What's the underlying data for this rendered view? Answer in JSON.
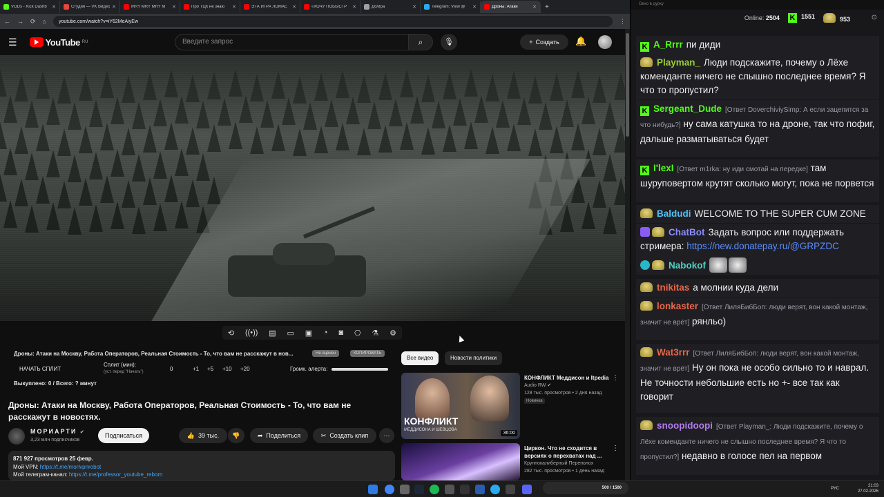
{
  "browser": {
    "tabs": [
      {
        "label": "VODs - Kick Dashb",
        "color": "#53fc18"
      },
      {
        "label": "Студия — VK Видео",
        "color": "#e8453c"
      },
      {
        "label": "MRY MRY MRY M",
        "color": "#ff0000"
      },
      {
        "label": "Про ТЦК не знаю",
        "color": "#ff0000"
      },
      {
        "label": "ЭТА ИГРА ЛОМАЕ",
        "color": "#ff0000"
      },
      {
        "label": "«ХОЧУ ПОБЫСТР",
        "color": "#ff0000"
      },
      {
        "label": "Дб/ира",
        "color": "#9aa0a6"
      },
      {
        "label": "Telegram: View @",
        "color": "#2aabee"
      },
      {
        "label": "Дроны: Атаки",
        "color": "#ff0000"
      }
    ],
    "url": "youtube.com/watch?v=iY62MeAiyEw"
  },
  "youtube": {
    "logo_text": "YouTube",
    "region": "RU",
    "search_placeholder": "Введите запрос",
    "create_label": "Создать",
    "ext": {
      "title": "Дроны: Атаки на Москву, Работа Операторов, Реальная Стоимость - То, что вам не расскажут в нов...",
      "btn_find": "Не оценен",
      "btn_copy": "КОПИРОВАТЬ",
      "start_split": "НАЧАТЬ СПЛИТ",
      "split_label": "Сплит (мин):",
      "split_sub": "(уст. перед \"Начать\")",
      "split_value": "0",
      "steps": [
        "+1",
        "+5",
        "+10",
        "+20"
      ],
      "alert_label": "Громк. алерта:",
      "done_text": "Выкуплено: 0 / Всего: ? минут"
    },
    "video_title": "Дроны: Атаки на Москву, Работа Операторов, Реальная Стоимость - То, что вам не расскажут в новостях.",
    "channel": {
      "name": "МОРИАРТИ",
      "subs": "3,23 млн подписчиков",
      "subscribe": "Подписаться"
    },
    "actions": {
      "likes": "39 тыс.",
      "share": "Поделиться",
      "clip": "Создать клип"
    },
    "description": {
      "stats": "871 927 просмотров  25 февр.",
      "vpn_label": "Мой VPN: ",
      "vpn_link": "https://t.me/morivpnrobot",
      "tg_label": "Мой телеграм-канал: ",
      "tg_link": "https://t.me/professor_youtube_reborn"
    },
    "chips": [
      "Все видео",
      "Новости политики"
    ],
    "recommendations": [
      {
        "title": "КОНФЛИКТ Меддисон и Itpedia",
        "channel": "Audio RW",
        "meta": "128 тыс. просмотров • 2 дня назад",
        "badge": "Новинка",
        "duration": "36:00",
        "thumb_text": "КОНФЛИКТ",
        "thumb_sub": "МЕДДИСОНА И ШЕВЦОВА"
      },
      {
        "title": "Циркон. Что не сходится в версиях о перехватах над ...",
        "channel": "Крупнокалиберный Переполох",
        "meta": "282 тыс. просмотров • 1 день назад"
      }
    ]
  },
  "chat": {
    "window_title": "Окно в дурку",
    "online_label": "Online:",
    "online": "2504",
    "kick_count": "1551",
    "other_count": "953",
    "messages": [
      {
        "user": "A_Rrrr",
        "color": "#53fc18",
        "icon": "k",
        "text": "пи диди"
      },
      {
        "user": "Playman_",
        "color": "#9acd32",
        "icon": "face",
        "text": "Люди подскажите, почему о Лёхе коменданте ничего не слышно последнее время? Я что то пропустил?"
      },
      {
        "user": "Sergeant_Dude",
        "color": "#53fc18",
        "icon": "k",
        "reply": "[Ответ DoverchiviySimp: А если зацепится за что нибудь?]",
        "text": "ну сама катушка то на дроне, так что пофиг, дальше разматываться будет"
      },
      {
        "user": "I'lexI",
        "color": "#53fc18",
        "icon": "k",
        "reply": "[Ответ m1rka: ну иди смотай на передке]",
        "text": "там шуруповертом крутят сколько могут, пока не порвется"
      },
      {
        "user": "Baldudi",
        "color": "#4fc3f7",
        "icon": "face",
        "text": "WELCOME TO THE SUPER CUM ZONE"
      },
      {
        "user": "ChatBot",
        "color": "#8c8cff",
        "icon": "bot",
        "text": "Задать вопрос или поддержать стримера: ",
        "link": "https://new.donatepay.ru/@GRPZDC"
      },
      {
        "user": "Nabokof",
        "color": "#4fd1c5",
        "icon": "check",
        "text": ""
      },
      {
        "user": "tnikitas",
        "color": "#e8674a",
        "icon": "face",
        "text": "а молнии куда дели"
      },
      {
        "user": "lonkaster",
        "color": "#e8674a",
        "icon": "face",
        "reply": "[Ответ ЛиляБибБоп: люди верят, вон какой монтаж, значит не врёт]",
        "text": "рянльо)"
      },
      {
        "user": "Wat3rrr",
        "color": "#e8674a",
        "icon": "face",
        "reply": "[Ответ ЛиляБибБоп: люди верят, вон какой монтаж, значит не врёт]",
        "text": "Ну он пока не особо сильно то и наврал. Не точности небольшие есть но +- все так как говорит"
      },
      {
        "user": "snoopidoopi",
        "color": "#b57cf0",
        "icon": "face",
        "reply": "[Ответ Playman_: Люди подскажите, почему о Лёхе коменданте ничего не слышно последнее время? Я что то пропустил?]",
        "text": "недавно в голосе пел на первом"
      }
    ]
  },
  "taskbar": {
    "widget": "500 / 1500",
    "lang": "РУС",
    "time": "21:03",
    "date": "27.02.2026"
  }
}
